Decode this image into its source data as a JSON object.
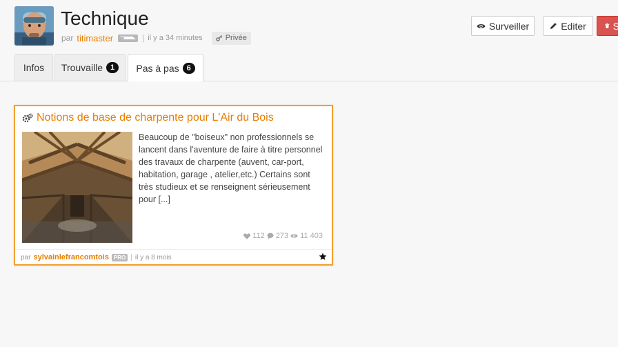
{
  "header": {
    "title": "Technique",
    "by_label": "par",
    "author": "titimaster",
    "separator": "|",
    "time": "il y a 34 minutes",
    "visibility": "Privée",
    "buttons": {
      "watch": "Surveiller",
      "edit": "Editer",
      "delete": "S"
    }
  },
  "tabs": [
    {
      "label": "Infos",
      "count": null
    },
    {
      "label": "Trouvaille",
      "count": "1"
    },
    {
      "label": "Pas à pas",
      "count": "6"
    }
  ],
  "active_tab": "Pas à pas",
  "card": {
    "title": "Notions de base de charpente pour L'Air du Bois",
    "description": "Beaucoup de \"boiseux\" non professionnels se lancent dans l'aventure de faire à titre personnel des travaux de charpente (auvent, car-port, habitation, garage , atelier,etc.) Certains sont très studieux et se renseignent sérieusement pour [...]",
    "stats": {
      "likes": "112",
      "comments": "273",
      "views": "11 403"
    },
    "footer": {
      "by_label": "par",
      "author": "sylvainlefrancomtois",
      "badge": "PRO",
      "separator": "|",
      "time": "il y a 8 mois"
    }
  },
  "colors": {
    "accent": "#e67e00",
    "card_border": "#f0a030",
    "delete_button": "#d9534f"
  },
  "icons": {
    "watch": "eye-icon",
    "edit": "pencil-icon",
    "delete": "trash-icon",
    "visibility": "key-icon",
    "card": "gears-icon",
    "likes": "heart-icon",
    "comments": "comment-icon",
    "views": "eye-icon",
    "bookmark": "star-icon"
  }
}
